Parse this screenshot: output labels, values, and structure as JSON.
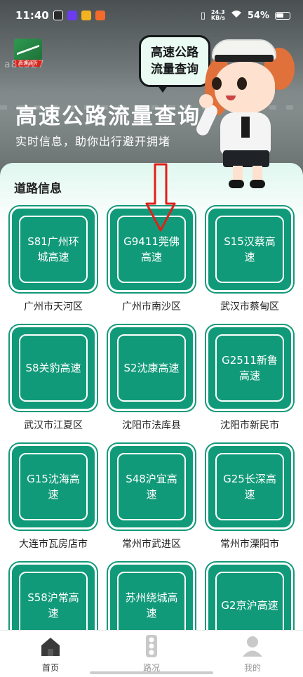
{
  "status_bar": {
    "time": "11:40",
    "net_speed_top": "24.3",
    "net_speed_bottom": "KB/s",
    "battery": "54%"
  },
  "hero": {
    "logo_text": "高速通行",
    "watermark": "a8c527",
    "bubble_line1": "高速公路",
    "bubble_line2": "流量查询",
    "title": "高速公路流量查询",
    "subtitle": "实时信息，助你出行避开拥堵"
  },
  "section": {
    "title": "道路信息"
  },
  "roads": [
    {
      "name": "S81广州环城高速",
      "place": "广州市天河区"
    },
    {
      "name": "G9411莞佛高速",
      "place": "广州市南沙区"
    },
    {
      "name": "S15汉蔡高速",
      "place": "武汉市蔡甸区"
    },
    {
      "name": "S8关豹高速",
      "place": "武汉市江夏区"
    },
    {
      "name": "S2沈康高速",
      "place": "沈阳市法库县"
    },
    {
      "name": "G2511新鲁高速",
      "place": "沈阳市新民市"
    },
    {
      "name": "G15沈海高速",
      "place": "大连市瓦房店市"
    },
    {
      "name": "S48沪宜高速",
      "place": "常州市武进区"
    },
    {
      "name": "G25长深高速",
      "place": "常州市溧阳市"
    },
    {
      "name": "S58沪常高速",
      "place": ""
    },
    {
      "name": "苏州绕城高速",
      "place": ""
    },
    {
      "name": "G2京沪高速",
      "place": ""
    }
  ],
  "nav": {
    "home": "首页",
    "traffic": "路况",
    "mine": "我的"
  },
  "colors": {
    "sign_green": "#119a79",
    "annotation_red": "#e0201a",
    "panel_mint": "#dff7ef"
  }
}
